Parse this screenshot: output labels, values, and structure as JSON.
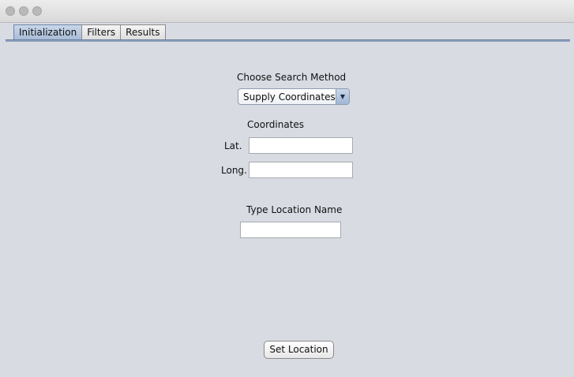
{
  "window": {
    "controls": [
      "close-icon",
      "minimize-icon",
      "zoom-icon"
    ]
  },
  "tabs": [
    {
      "label": "Initialization",
      "active": true
    },
    {
      "label": "Filters",
      "active": false
    },
    {
      "label": "Results",
      "active": false
    }
  ],
  "search": {
    "method_label": "Choose Search Method",
    "method_selected": "Supply Coordinates",
    "dropdown_icon": "chevron-down-icon"
  },
  "coordinates": {
    "heading": "Coordinates",
    "lat_label": "Lat.",
    "lat_value": "",
    "long_label": "Long.",
    "long_value": ""
  },
  "location": {
    "heading": "Type Location Name",
    "value": ""
  },
  "actions": {
    "set_location_label": "Set Location"
  },
  "colors": {
    "active_tab": "#a7bcd8",
    "window_bg": "#d8dbe2"
  }
}
